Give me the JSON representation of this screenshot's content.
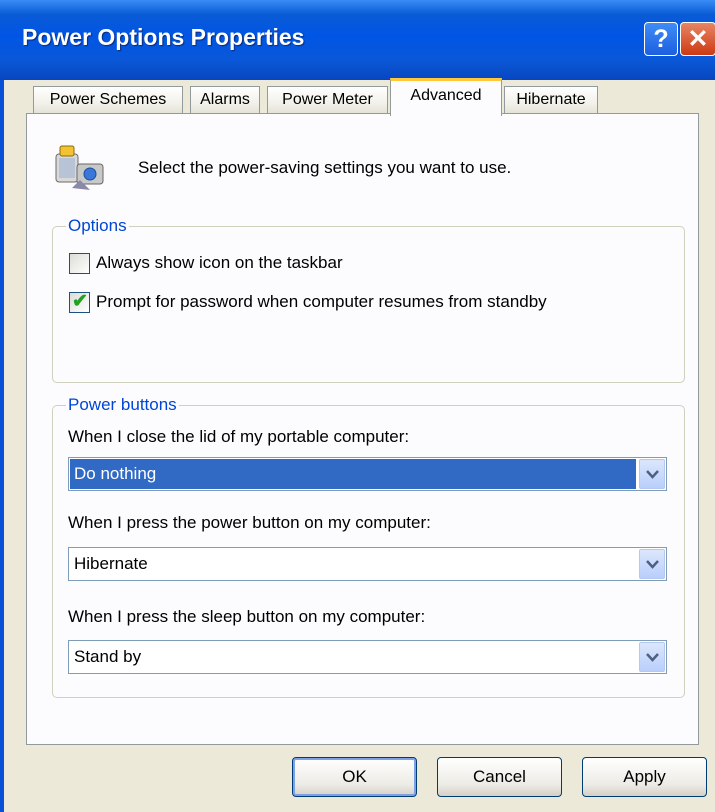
{
  "window": {
    "title": "Power Options Properties"
  },
  "titlebar": {
    "help_glyph": "?",
    "close_glyph": "✕"
  },
  "tabs": [
    {
      "label": "Power Schemes"
    },
    {
      "label": "Alarms"
    },
    {
      "label": "Power Meter"
    },
    {
      "label": "Advanced",
      "active": true
    },
    {
      "label": "Hibernate"
    }
  ],
  "header": {
    "icon": "power-options-icon",
    "text": "Select the power-saving settings you want to use."
  },
  "options": {
    "label": "Options",
    "always_show_icon": {
      "label": "Always show icon on the taskbar",
      "checked": false
    },
    "prompt_password": {
      "label": "Prompt for password when computer resumes from standby",
      "checked": true
    },
    "check_glyph": "✔"
  },
  "power_buttons": {
    "label": "Power buttons",
    "lid": {
      "label": "When I close the lid of my portable computer:",
      "value": "Do nothing"
    },
    "power": {
      "label": "When I press the power button on my computer:",
      "value": "Hibernate"
    },
    "sleep": {
      "label": "When I press the sleep button on my computer:",
      "value": "Stand by"
    }
  },
  "buttons": {
    "ok": "OK",
    "cancel": "Cancel",
    "apply": "Apply"
  },
  "colors": {
    "title_bar": "#0055e5",
    "group_label": "#0046d5",
    "selection": "#316ac5",
    "active_tab_accent": "#ffc83c"
  }
}
